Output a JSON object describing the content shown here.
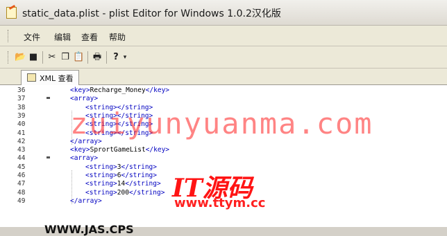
{
  "window": {
    "title": "static_data.plist - plist Editor for Windows 1.0.2汉化版"
  },
  "menu": {
    "items": [
      "文件",
      "编辑",
      "查看",
      "帮助"
    ]
  },
  "tabs": [
    {
      "label": "XML 查看"
    }
  ],
  "editor": {
    "lines": [
      {
        "num": "36",
        "fold": false,
        "indent": 0,
        "pre": "<key>",
        "text": "Recharge_Money",
        "post": "</key>"
      },
      {
        "num": "37",
        "fold": true,
        "indent": 0,
        "pre": "<array>",
        "text": "",
        "post": ""
      },
      {
        "num": "38",
        "fold": false,
        "indent": 1,
        "pre": "<string></string>",
        "text": "",
        "post": ""
      },
      {
        "num": "39",
        "fold": false,
        "indent": 1,
        "pre": "<string></string>",
        "text": "",
        "post": ""
      },
      {
        "num": "40",
        "fold": false,
        "indent": 1,
        "pre": "<string></string>",
        "text": "",
        "post": ""
      },
      {
        "num": "41",
        "fold": false,
        "indent": 1,
        "pre": "<string></string>",
        "text": "",
        "post": ""
      },
      {
        "num": "42",
        "fold": false,
        "indent": 0,
        "pre": "</array>",
        "text": "",
        "post": ""
      },
      {
        "num": "43",
        "fold": false,
        "indent": 0,
        "pre": "<key>",
        "text": "SprortGameList",
        "post": "</key>"
      },
      {
        "num": "44",
        "fold": true,
        "indent": 0,
        "pre": "<array>",
        "text": "",
        "post": ""
      },
      {
        "num": "45",
        "fold": false,
        "indent": 1,
        "pre": "<string>",
        "text": "3",
        "post": "</string>"
      },
      {
        "num": "46",
        "fold": false,
        "indent": 1,
        "pre": "<string>",
        "text": "6",
        "post": "</string>"
      },
      {
        "num": "47",
        "fold": false,
        "indent": 1,
        "pre": "<string>",
        "text": "14",
        "post": "</string>"
      },
      {
        "num": "48",
        "fold": false,
        "indent": 1,
        "pre": "<string>",
        "text": "200",
        "post": "</string>"
      },
      {
        "num": "49",
        "fold": false,
        "indent": 0,
        "pre": "</array>",
        "text": "",
        "post": ""
      }
    ]
  },
  "watermarks": {
    "domain": "zuiyunyuanma.com",
    "brand": "IT源码",
    "url": "www.ttym.cc",
    "partial": "WWW.JAS.CPS"
  },
  "colors": {
    "tag": "#0000c0",
    "watermark": "#ff2020"
  }
}
